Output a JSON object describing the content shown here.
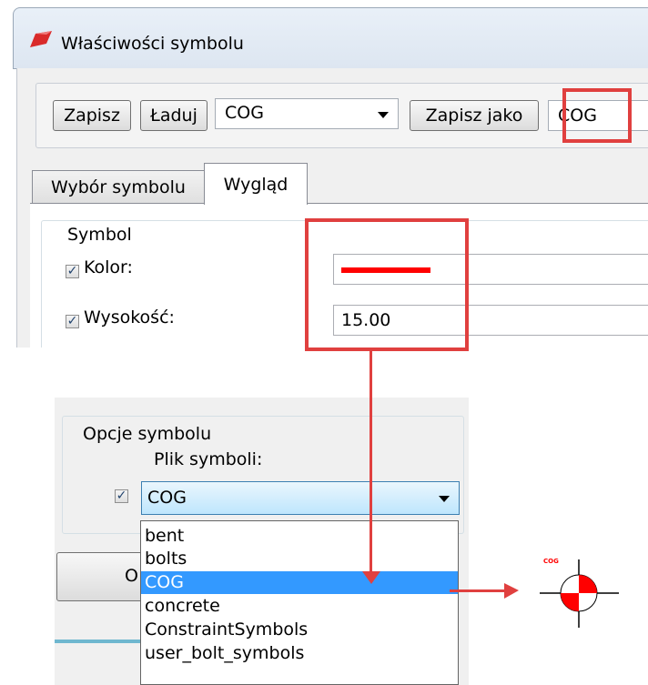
{
  "window": {
    "title": "Właściwości symbolu",
    "accent_color": "#e0403f"
  },
  "toolbar": {
    "save_label": "Zapisz",
    "load_label": "Ładuj",
    "preset_value": "COG",
    "save_as_label": "Zapisz jako",
    "save_as_value": "COG"
  },
  "tabs": [
    {
      "label": "Wybór symbolu",
      "active": false
    },
    {
      "label": "Wygląd",
      "active": true
    }
  ],
  "symbol_group": {
    "title": "Symbol",
    "color_label": "Kolor:",
    "color_checked": true,
    "color_value_hex": "#ff0000",
    "height_label": "Wysokość:",
    "height_checked": true,
    "height_value": "15.00"
  },
  "symbol_options": {
    "title": "Opcje symbolu",
    "file_label": "Plik symboli:",
    "file_checked": true,
    "selected_value": "COG",
    "options": [
      "bent",
      "bolts",
      "COG",
      "concrete",
      "ConstraintSymbols",
      "user_bolt_symbols"
    ],
    "selected_index": 2,
    "partial_button_text": "O"
  },
  "preview": {
    "label": "COG",
    "icon": "cog-symbol-icon"
  }
}
